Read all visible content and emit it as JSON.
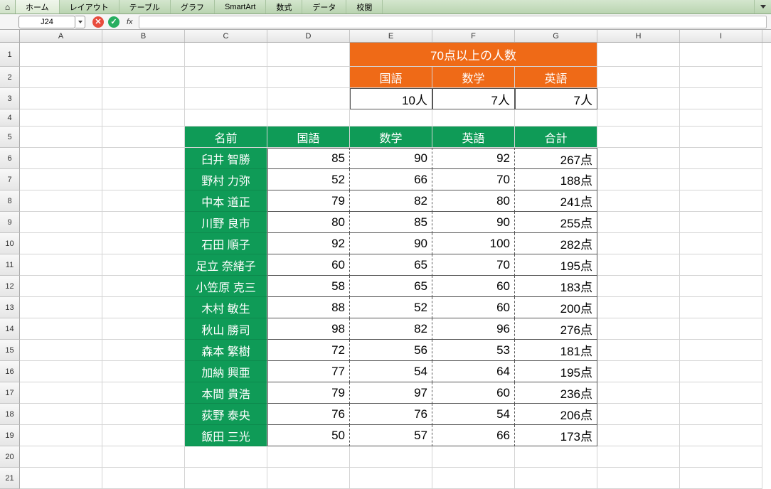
{
  "ribbon": {
    "home_icon": "⌂",
    "tabs": [
      "ホーム",
      "レイアウト",
      "テーブル",
      "グラフ",
      "SmartArt",
      "数式",
      "データ",
      "校閲"
    ]
  },
  "namebox": {
    "ref": "J24"
  },
  "fx_label": "fx",
  "columns": [
    "A",
    "B",
    "C",
    "D",
    "E",
    "F",
    "G",
    "H",
    "I"
  ],
  "row_nums": [
    "1",
    "2",
    "3",
    "4",
    "5",
    "6",
    "7",
    "8",
    "9",
    "10",
    "11",
    "12",
    "13",
    "14",
    "15",
    "16",
    "17",
    "18",
    "19",
    "20",
    "21"
  ],
  "summary": {
    "title": "70点以上の人数",
    "headers": [
      "国語",
      "数学",
      "英語"
    ],
    "values": [
      "10人",
      "7人",
      "7人"
    ]
  },
  "table": {
    "headers": [
      "名前",
      "国語",
      "数学",
      "英語",
      "合計"
    ],
    "rows": [
      {
        "name": "臼井 智勝",
        "s": [
          85,
          90,
          92
        ],
        "t": "267点"
      },
      {
        "name": "野村 力弥",
        "s": [
          52,
          66,
          70
        ],
        "t": "188点"
      },
      {
        "name": "中本 道正",
        "s": [
          79,
          82,
          80
        ],
        "t": "241点"
      },
      {
        "name": "川野 良市",
        "s": [
          80,
          85,
          90
        ],
        "t": "255点"
      },
      {
        "name": "石田 順子",
        "s": [
          92,
          90,
          100
        ],
        "t": "282点"
      },
      {
        "name": "足立 奈緒子",
        "s": [
          60,
          65,
          70
        ],
        "t": "195点"
      },
      {
        "name": "小笠原 克三",
        "s": [
          58,
          65,
          60
        ],
        "t": "183点"
      },
      {
        "name": "木村 敏生",
        "s": [
          88,
          52,
          60
        ],
        "t": "200点"
      },
      {
        "name": "秋山 勝司",
        "s": [
          98,
          82,
          96
        ],
        "t": "276点"
      },
      {
        "name": "森本 繁樹",
        "s": [
          72,
          56,
          53
        ],
        "t": "181点"
      },
      {
        "name": "加納 興亜",
        "s": [
          77,
          54,
          64
        ],
        "t": "195点"
      },
      {
        "name": "本間 貴浩",
        "s": [
          79,
          97,
          60
        ],
        "t": "236点"
      },
      {
        "name": "荻野 泰央",
        "s": [
          76,
          76,
          54
        ],
        "t": "206点"
      },
      {
        "name": "飯田 三光",
        "s": [
          50,
          57,
          66
        ],
        "t": "173点"
      }
    ]
  },
  "chart_data": {
    "type": "table",
    "title": "70点以上の人数 / 成績表",
    "summary": {
      "国語": 10,
      "数学": 7,
      "英語": 7
    },
    "columns": [
      "名前",
      "国語",
      "数学",
      "英語",
      "合計"
    ],
    "rows": [
      [
        "臼井 智勝",
        85,
        90,
        92,
        267
      ],
      [
        "野村 力弥",
        52,
        66,
        70,
        188
      ],
      [
        "中本 道正",
        79,
        82,
        80,
        241
      ],
      [
        "川野 良市",
        80,
        85,
        90,
        255
      ],
      [
        "石田 順子",
        92,
        90,
        100,
        282
      ],
      [
        "足立 奈緒子",
        60,
        65,
        70,
        195
      ],
      [
        "小笠原 克三",
        58,
        65,
        60,
        183
      ],
      [
        "木村 敏生",
        88,
        52,
        60,
        200
      ],
      [
        "秋山 勝司",
        98,
        82,
        96,
        276
      ],
      [
        "森本 繁樹",
        72,
        56,
        53,
        181
      ],
      [
        "加納 興亜",
        77,
        54,
        64,
        195
      ],
      [
        "本間 貴浩",
        79,
        97,
        60,
        236
      ],
      [
        "荻野 泰央",
        76,
        76,
        54,
        206
      ],
      [
        "飯田 三光",
        50,
        57,
        66,
        173
      ]
    ]
  }
}
